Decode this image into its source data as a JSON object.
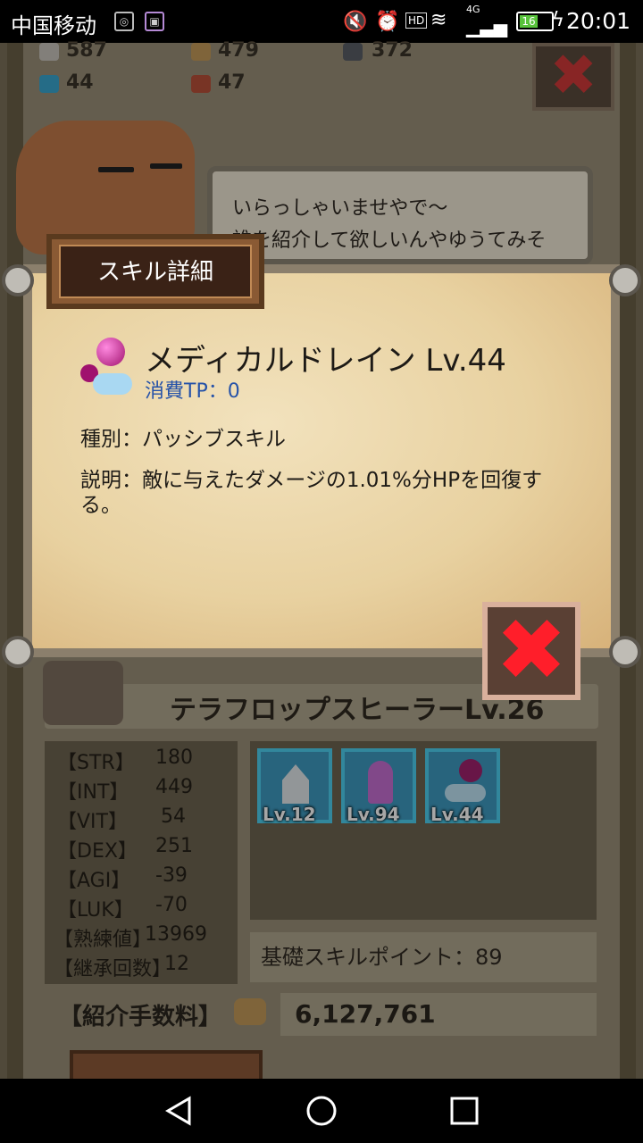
{
  "status_bar": {
    "carrier": "中国移动",
    "network": "4G",
    "hd": "HD",
    "battery": "16",
    "time": "20:01"
  },
  "resources": [
    {
      "icon": "stone-icon",
      "value": "587"
    },
    {
      "icon": "wood-icon",
      "value": "479"
    },
    {
      "icon": "ore-icon",
      "value": "372"
    },
    {
      "icon": "crystal-icon",
      "value": "44"
    },
    {
      "icon": "leather-icon",
      "value": "47"
    }
  ],
  "npc": {
    "speech_line1": "いらっしゃいませやで〜",
    "speech_line2": "誰を紹介して欲しいんやゆうてみそ"
  },
  "hero": {
    "name": "テラフロップスヒーラーLv.26",
    "stats": [
      {
        "label": "【STR】",
        "value": "180"
      },
      {
        "label": "【INT】",
        "value": "449"
      },
      {
        "label": "【VIT】",
        "value": "54"
      },
      {
        "label": "【DEX】",
        "value": "251"
      },
      {
        "label": "【AGI】",
        "value": "-39"
      },
      {
        "label": "【LUK】",
        "value": "-70"
      },
      {
        "label": "【熟練値】",
        "value": "13969"
      },
      {
        "label": "【継承回数】",
        "value": "12"
      }
    ],
    "skills": [
      {
        "icon": "hp-crystal-icon",
        "level": "Lv.12"
      },
      {
        "icon": "purple-figure-icon",
        "level": "Lv.94"
      },
      {
        "icon": "orb-cloud-icon",
        "level": "Lv.44"
      }
    ],
    "skill_points": "基礎スキルポイント：89",
    "fee_label": "【紹介手数料】",
    "fee_value": "6,127,761"
  },
  "dialog": {
    "title": "スキル詳細",
    "skill_name": "メディカルドレイン Lv.44",
    "tp_cost": "消費TP：0",
    "kind": "種別：パッシブスキル",
    "description": "説明：敵に与えたダメージの1.01%分HPを回復する。"
  },
  "colors": {
    "close_red": "#ff1e2a",
    "tp_blue": "#2552a8",
    "parchment": "#ead6ab"
  }
}
